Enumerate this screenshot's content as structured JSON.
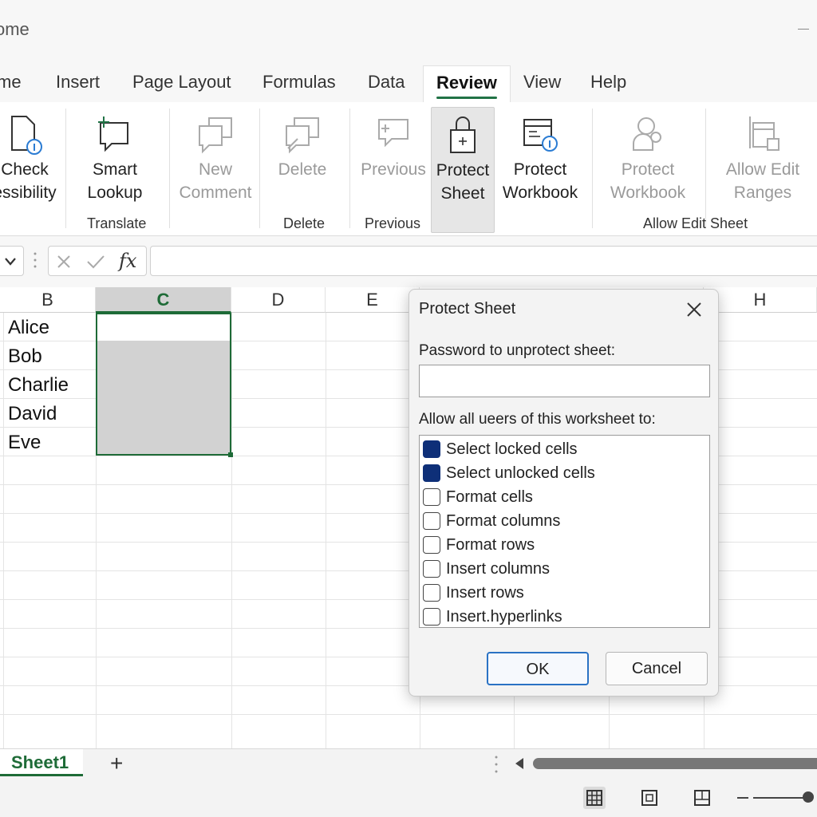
{
  "window": {
    "title": "ome"
  },
  "tabs": [
    "me",
    "Insert",
    "Page Layout",
    "Formulas",
    "Data",
    "Review",
    "View",
    "Help"
  ],
  "active_tab": "Review",
  "ribbon": {
    "check_accessibility": {
      "line1": "Check",
      "line2": "essibility"
    },
    "smart_lookup": {
      "line1": "Smart",
      "line2": "Lookup"
    },
    "new_comment": {
      "line1": "New",
      "line2": "Comment"
    },
    "delete": {
      "line1": "Delete"
    },
    "previous": {
      "line1": "Previous"
    },
    "protect_sheet": {
      "line1": "Protect",
      "line2": "Sheet"
    },
    "protect_workbook": {
      "line1": "Protect",
      "line2": "Workbook"
    },
    "protect_workbook_disabled": {
      "line1": "Protect",
      "line2": "Workbook"
    },
    "allow_edit_ranges": {
      "line1": "Allow Edit",
      "line2": "Ranges"
    },
    "groups": {
      "translate": "Translate",
      "delete": "Delete",
      "previous": "Previous",
      "allow_edit_sheet": "Allow Edit Sheet"
    }
  },
  "formula_bar": {
    "fx": "fx",
    "value": ""
  },
  "grid": {
    "columns": [
      "B",
      "C",
      "D",
      "E",
      "H"
    ],
    "selected_column": "C",
    "rows": [
      "Alice",
      "Bob",
      "Charlie",
      "David",
      "Eve"
    ]
  },
  "dialog": {
    "title": "Protect Sheet",
    "password_label": "Password to unprotect sheet:",
    "password_value": "",
    "allow_label": "Allow all ueers of this worksheet to:",
    "options": [
      {
        "label": "Select locked cells",
        "checked": true
      },
      {
        "label": "Select unlocked cells",
        "checked": true
      },
      {
        "label": "Format cells",
        "checked": false
      },
      {
        "label": "Format columns",
        "checked": false
      },
      {
        "label": "Format rows",
        "checked": false
      },
      {
        "label": "Insert columns",
        "checked": false
      },
      {
        "label": "Insert rows",
        "checked": false
      },
      {
        "label": "Insert.hyperlinks",
        "checked": false
      }
    ],
    "ok_label": "OK",
    "cancel_label": "Cancel"
  },
  "sheets": {
    "active": "Sheet1",
    "add_label": "+"
  },
  "colors": {
    "accent_green": "#1e6b37",
    "checkbox_checked": "#0e2f78",
    "ok_border": "#2a72c4"
  }
}
